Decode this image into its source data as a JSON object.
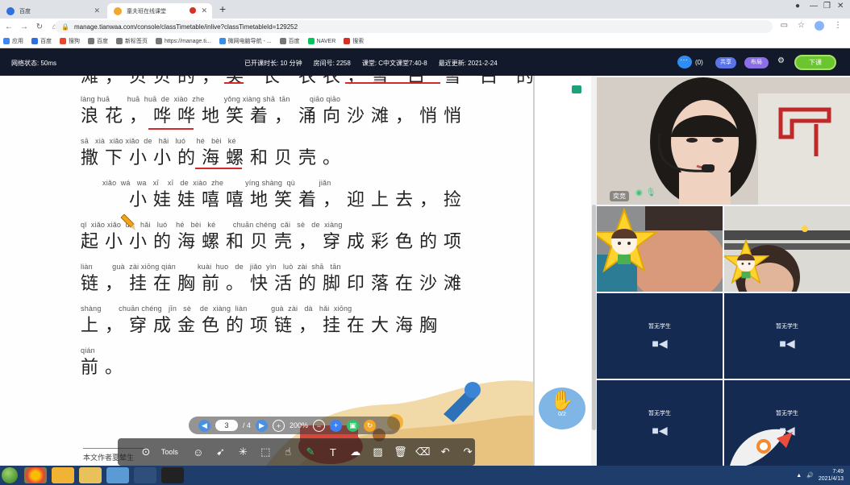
{
  "browser": {
    "tabs": [
      {
        "label": "百度",
        "active": false
      },
      {
        "label": "童夫班在线课堂",
        "active": true
      }
    ],
    "url": "manage.tianwaa.com/console/classTimetable/inlive?classTimetableId=129252",
    "bookmarks": [
      "应用",
      "百度",
      "搜狗",
      "百度",
      "新标签页",
      "https://manage.ti...",
      "微网电脑导航 - ...",
      "百度",
      "NAVER",
      "搜索"
    ]
  },
  "appbar": {
    "network_status": "网络状态: 50ms",
    "class_duration": "已开课时长: 10 分钟",
    "room_number": "房间号:  2258",
    "class_name": "课堂: C中文课堂7:40-8",
    "last_update": "最近更新: 2021-2-24",
    "chat_count": "(0)",
    "share_label": "共享",
    "layout_label": "布局",
    "end_class_label": "下课"
  },
  "lesson": {
    "lines": [
      {
        "pinyin": "",
        "hanzi": "滩，贝贝的，笑 长 衣衣，雪 白 雪 白 的"
      },
      {
        "pinyin": "làng huā        huā  huā  de  xiào  zhe         yǒng xiàng shā  tān         qiāo qiāo",
        "hanzi": "浪花，哗哗地笑着，涌向沙滩，悄悄"
      },
      {
        "pinyin": "sā   xià  xiǎo xiǎo  de   hǎi   luó     hé   bèi   ké",
        "hanzi": "撒下小小的海螺和贝壳。"
      },
      {
        "pinyin": "          xiǎo  wá   wa   xī    xī   de  xiào  zhe          yíng shàng  qù           jiǎn",
        "hanzi": "    小娃娃嘻嘻地笑着，迎上去，捡"
      },
      {
        "pinyin": "qǐ  xiǎo xiǎo  de   hǎi   luó    hé   bèi   ké        chuān chéng  cǎi   sè   de  xiàng",
        "hanzi": "起小小的海螺和贝壳，穿成彩色的项"
      },
      {
        "pinyin": "liàn         guà  zài xiōng qián          kuài  huo   de   jiǎo  yìn   luò  zài  shā   tān",
        "hanzi": "链，挂在胸前。快活的脚印落在沙滩"
      },
      {
        "pinyin": "shàng        chuān chéng   jīn   sè    de  xiàng  liàn           guà  zài   dà   hǎi  xiōng",
        "hanzi": "上，穿成金色的项链，挂在大海胸"
      },
      {
        "pinyin": "qián",
        "hanzi": "前。"
      }
    ],
    "footnote": "本文作者夏辇生"
  },
  "pagenav": {
    "current_page": "3",
    "total_pages": "/ 4",
    "zoom": "200%"
  },
  "toolbar": {
    "tools_label": "Tools"
  },
  "raise_hand": {
    "count": "0/2"
  },
  "video": {
    "teacher_name": "奕竞",
    "empty_label": "暂无学生",
    "empty_slots": 4
  },
  "taskbar": {
    "time": "7:49",
    "date": "2021/4/13"
  },
  "colors": {
    "appbar": "#12192b",
    "end_class": "#6ac52e",
    "share": "#5a74e8",
    "layout": "#8c6ee6",
    "underline": "#d42a2a",
    "empty_tile": "#142a50"
  }
}
